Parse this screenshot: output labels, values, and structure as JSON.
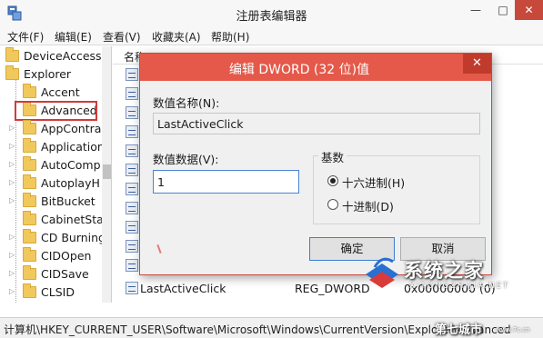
{
  "window": {
    "title": "注册表编辑器",
    "minimize": "—",
    "maximize": "□",
    "close": "✕"
  },
  "menu": [
    "文件(F)",
    "编辑(E)",
    "查看(V)",
    "收藏夹(A)",
    "帮助(H)"
  ],
  "tree": {
    "items": [
      {
        "label": "DeviceAccess",
        "level": 0
      },
      {
        "label": "Explorer",
        "level": 0
      },
      {
        "label": "Accent",
        "level": 1
      },
      {
        "label": "Advanced",
        "level": 1,
        "selected": true
      },
      {
        "label": "AppContra",
        "level": 1
      },
      {
        "label": "Application",
        "level": 1
      },
      {
        "label": "AutoComp",
        "level": 1
      },
      {
        "label": "AutoplayH",
        "level": 1
      },
      {
        "label": "BitBucket",
        "level": 1
      },
      {
        "label": "CabinetSta",
        "level": 1
      },
      {
        "label": "CD Burning",
        "level": 1
      },
      {
        "label": "CIDOpen",
        "level": 1
      },
      {
        "label": "CIDSave",
        "level": 1
      },
      {
        "label": "CLSID",
        "level": 1
      }
    ]
  },
  "values": {
    "column_name": "名称",
    "last_row": {
      "name": "LastActiveClick",
      "type": "REG_DWORD",
      "data": "0x00000000 (0)"
    }
  },
  "statusbar": {
    "path": "计算机\\HKEY_CURRENT_USER\\Software\\Microsoft\\Windows\\CurrentVersion\\Explorer\\Advanced"
  },
  "dialog": {
    "title": "编辑 DWORD (32 位)值",
    "close": "✕",
    "value_name_label": "数值名称(N):",
    "value_name": "LastActiveClick",
    "value_data_label": "数值数据(V):",
    "value_data": "1",
    "base_label": "基数",
    "base_options": [
      {
        "label": "十六进制(H)",
        "checked": true
      },
      {
        "label": "十进制(D)",
        "checked": false
      }
    ],
    "ok": "确定",
    "cancel": "取消"
  },
  "watermark": {
    "brand": "系统之家",
    "url": "XITONGZHIJIA.NET",
    "overlay": "第七城市",
    "overlay_small": "www.7c.cn"
  },
  "colors": {
    "dialog_title_bg": "#e4594a",
    "selection_box": "#d23a3a",
    "close_button": "#c7493b"
  }
}
